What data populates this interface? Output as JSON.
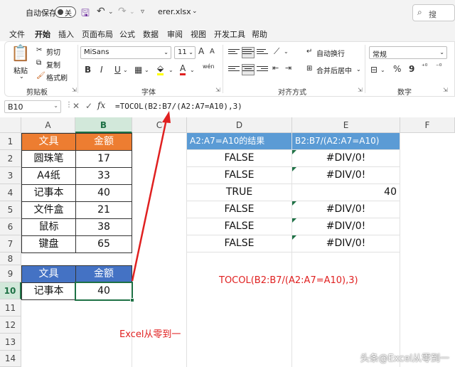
{
  "titlebar": {
    "autosave_label": "自动保存",
    "autosave_state": "关",
    "filename": "erer.xlsx",
    "dropdown": "⌄",
    "search_label": "搜"
  },
  "tabs": [
    "文件",
    "开始",
    "插入",
    "页面布局",
    "公式",
    "数据",
    "审阅",
    "视图",
    "开发工具",
    "帮助"
  ],
  "ribbon": {
    "clipboard": {
      "paste": "粘贴",
      "cut": "剪切",
      "copy": "复制",
      "format_painter": "格式刷",
      "group": "剪贴板"
    },
    "font": {
      "font_name": "MiSans",
      "font_size": "11",
      "bold": "B",
      "italic": "I",
      "underline": "U",
      "group": "字体",
      "grow": "A",
      "shrink": "A",
      "wen": "wén"
    },
    "alignment": {
      "wrap": "自动换行",
      "merge": "合并后居中",
      "group": "对齐方式"
    },
    "number": {
      "format": "常规",
      "group": "数字",
      "percent": "%",
      "comma": "9"
    }
  },
  "formula_bar": {
    "name_box": "B10",
    "fx": "fx",
    "formula": "=TOCOL(B2:B7/(A2:A7=A10),3)"
  },
  "columns": [
    "A",
    "B",
    "C",
    "D",
    "E",
    "F"
  ],
  "rows": [
    "1",
    "2",
    "3",
    "4",
    "5",
    "6",
    "7",
    "8",
    "9",
    "10",
    "11",
    "12",
    "13",
    "14"
  ],
  "table1": {
    "headers": [
      "文具",
      "金额"
    ],
    "rows": [
      [
        "圆珠笔",
        "17"
      ],
      [
        "A4纸",
        "33"
      ],
      [
        "记事本",
        "40"
      ],
      [
        "文件盒",
        "21"
      ],
      [
        "鼠标",
        "38"
      ],
      [
        "键盘",
        "65"
      ]
    ]
  },
  "table2": {
    "headers": [
      "文具",
      "金额"
    ],
    "row": [
      "记事本",
      "40"
    ]
  },
  "results": {
    "d_header": "A2:A7=A10的结果",
    "e_header": "B2:B7/(A2:A7=A10)",
    "d_values": [
      "FALSE",
      "FALSE",
      "TRUE",
      "FALSE",
      "FALSE",
      "FALSE"
    ],
    "e_values": [
      "#DIV/0!",
      "#DIV/0!",
      "40",
      "#DIV/0!",
      "#DIV/0!",
      "#DIV/0!"
    ]
  },
  "annotations": {
    "formula_note": "TOCOL(B2:B7/(A2:A7=A10),3)",
    "brand_note": "Excel从零到一",
    "watermark": "头条@Excel从零到一"
  },
  "colors": {
    "orange_header": "#ed7d31",
    "blue_header": "#4472c4",
    "light_blue_header": "#5b9bd5",
    "excel_green": "#1e7145",
    "annotation_red": "#e02020"
  }
}
